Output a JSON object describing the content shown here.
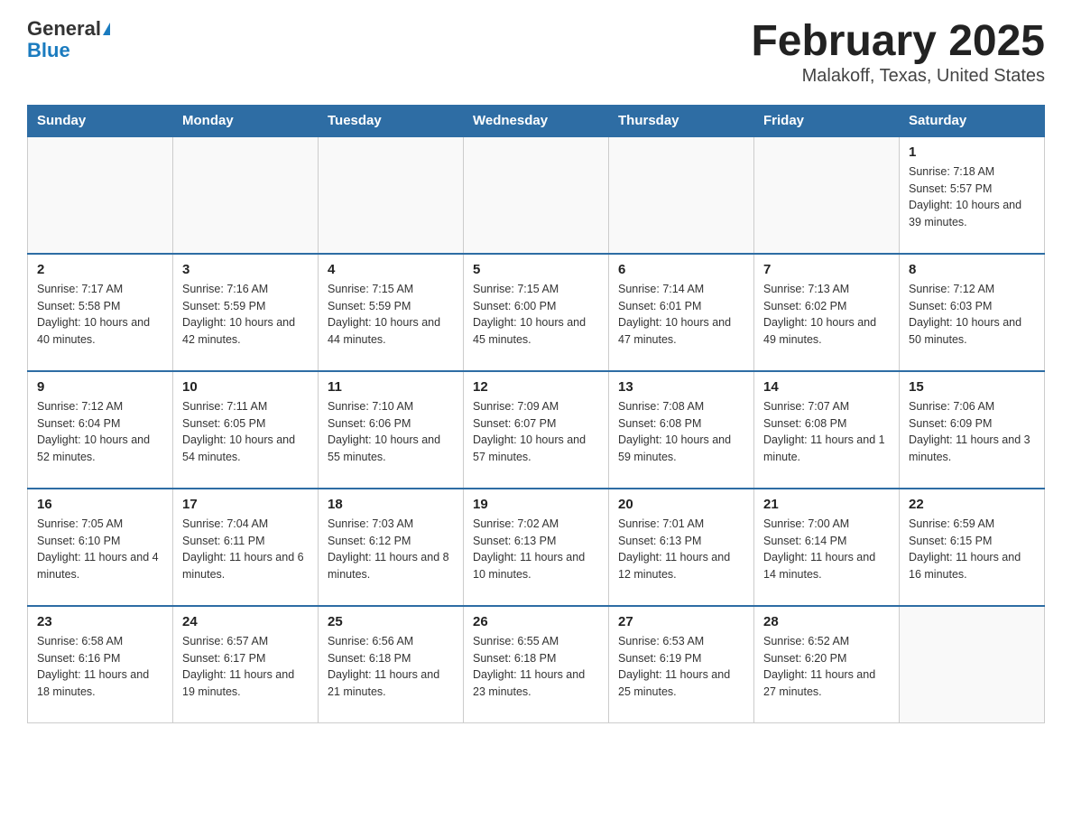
{
  "logo": {
    "general": "General",
    "triangle": "▲",
    "blue": "Blue"
  },
  "title": "February 2025",
  "subtitle": "Malakoff, Texas, United States",
  "days_of_week": [
    "Sunday",
    "Monday",
    "Tuesday",
    "Wednesday",
    "Thursday",
    "Friday",
    "Saturday"
  ],
  "weeks": [
    [
      {
        "day": "",
        "sunrise": "",
        "sunset": "",
        "daylight": ""
      },
      {
        "day": "",
        "sunrise": "",
        "sunset": "",
        "daylight": ""
      },
      {
        "day": "",
        "sunrise": "",
        "sunset": "",
        "daylight": ""
      },
      {
        "day": "",
        "sunrise": "",
        "sunset": "",
        "daylight": ""
      },
      {
        "day": "",
        "sunrise": "",
        "sunset": "",
        "daylight": ""
      },
      {
        "day": "",
        "sunrise": "",
        "sunset": "",
        "daylight": ""
      },
      {
        "day": "1",
        "sunrise": "Sunrise: 7:18 AM",
        "sunset": "Sunset: 5:57 PM",
        "daylight": "Daylight: 10 hours and 39 minutes."
      }
    ],
    [
      {
        "day": "2",
        "sunrise": "Sunrise: 7:17 AM",
        "sunset": "Sunset: 5:58 PM",
        "daylight": "Daylight: 10 hours and 40 minutes."
      },
      {
        "day": "3",
        "sunrise": "Sunrise: 7:16 AM",
        "sunset": "Sunset: 5:59 PM",
        "daylight": "Daylight: 10 hours and 42 minutes."
      },
      {
        "day": "4",
        "sunrise": "Sunrise: 7:15 AM",
        "sunset": "Sunset: 5:59 PM",
        "daylight": "Daylight: 10 hours and 44 minutes."
      },
      {
        "day": "5",
        "sunrise": "Sunrise: 7:15 AM",
        "sunset": "Sunset: 6:00 PM",
        "daylight": "Daylight: 10 hours and 45 minutes."
      },
      {
        "day": "6",
        "sunrise": "Sunrise: 7:14 AM",
        "sunset": "Sunset: 6:01 PM",
        "daylight": "Daylight: 10 hours and 47 minutes."
      },
      {
        "day": "7",
        "sunrise": "Sunrise: 7:13 AM",
        "sunset": "Sunset: 6:02 PM",
        "daylight": "Daylight: 10 hours and 49 minutes."
      },
      {
        "day": "8",
        "sunrise": "Sunrise: 7:12 AM",
        "sunset": "Sunset: 6:03 PM",
        "daylight": "Daylight: 10 hours and 50 minutes."
      }
    ],
    [
      {
        "day": "9",
        "sunrise": "Sunrise: 7:12 AM",
        "sunset": "Sunset: 6:04 PM",
        "daylight": "Daylight: 10 hours and 52 minutes."
      },
      {
        "day": "10",
        "sunrise": "Sunrise: 7:11 AM",
        "sunset": "Sunset: 6:05 PM",
        "daylight": "Daylight: 10 hours and 54 minutes."
      },
      {
        "day": "11",
        "sunrise": "Sunrise: 7:10 AM",
        "sunset": "Sunset: 6:06 PM",
        "daylight": "Daylight: 10 hours and 55 minutes."
      },
      {
        "day": "12",
        "sunrise": "Sunrise: 7:09 AM",
        "sunset": "Sunset: 6:07 PM",
        "daylight": "Daylight: 10 hours and 57 minutes."
      },
      {
        "day": "13",
        "sunrise": "Sunrise: 7:08 AM",
        "sunset": "Sunset: 6:08 PM",
        "daylight": "Daylight: 10 hours and 59 minutes."
      },
      {
        "day": "14",
        "sunrise": "Sunrise: 7:07 AM",
        "sunset": "Sunset: 6:08 PM",
        "daylight": "Daylight: 11 hours and 1 minute."
      },
      {
        "day": "15",
        "sunrise": "Sunrise: 7:06 AM",
        "sunset": "Sunset: 6:09 PM",
        "daylight": "Daylight: 11 hours and 3 minutes."
      }
    ],
    [
      {
        "day": "16",
        "sunrise": "Sunrise: 7:05 AM",
        "sunset": "Sunset: 6:10 PM",
        "daylight": "Daylight: 11 hours and 4 minutes."
      },
      {
        "day": "17",
        "sunrise": "Sunrise: 7:04 AM",
        "sunset": "Sunset: 6:11 PM",
        "daylight": "Daylight: 11 hours and 6 minutes."
      },
      {
        "day": "18",
        "sunrise": "Sunrise: 7:03 AM",
        "sunset": "Sunset: 6:12 PM",
        "daylight": "Daylight: 11 hours and 8 minutes."
      },
      {
        "day": "19",
        "sunrise": "Sunrise: 7:02 AM",
        "sunset": "Sunset: 6:13 PM",
        "daylight": "Daylight: 11 hours and 10 minutes."
      },
      {
        "day": "20",
        "sunrise": "Sunrise: 7:01 AM",
        "sunset": "Sunset: 6:13 PM",
        "daylight": "Daylight: 11 hours and 12 minutes."
      },
      {
        "day": "21",
        "sunrise": "Sunrise: 7:00 AM",
        "sunset": "Sunset: 6:14 PM",
        "daylight": "Daylight: 11 hours and 14 minutes."
      },
      {
        "day": "22",
        "sunrise": "Sunrise: 6:59 AM",
        "sunset": "Sunset: 6:15 PM",
        "daylight": "Daylight: 11 hours and 16 minutes."
      }
    ],
    [
      {
        "day": "23",
        "sunrise": "Sunrise: 6:58 AM",
        "sunset": "Sunset: 6:16 PM",
        "daylight": "Daylight: 11 hours and 18 minutes."
      },
      {
        "day": "24",
        "sunrise": "Sunrise: 6:57 AM",
        "sunset": "Sunset: 6:17 PM",
        "daylight": "Daylight: 11 hours and 19 minutes."
      },
      {
        "day": "25",
        "sunrise": "Sunrise: 6:56 AM",
        "sunset": "Sunset: 6:18 PM",
        "daylight": "Daylight: 11 hours and 21 minutes."
      },
      {
        "day": "26",
        "sunrise": "Sunrise: 6:55 AM",
        "sunset": "Sunset: 6:18 PM",
        "daylight": "Daylight: 11 hours and 23 minutes."
      },
      {
        "day": "27",
        "sunrise": "Sunrise: 6:53 AM",
        "sunset": "Sunset: 6:19 PM",
        "daylight": "Daylight: 11 hours and 25 minutes."
      },
      {
        "day": "28",
        "sunrise": "Sunrise: 6:52 AM",
        "sunset": "Sunset: 6:20 PM",
        "daylight": "Daylight: 11 hours and 27 minutes."
      },
      {
        "day": "",
        "sunrise": "",
        "sunset": "",
        "daylight": ""
      }
    ]
  ]
}
